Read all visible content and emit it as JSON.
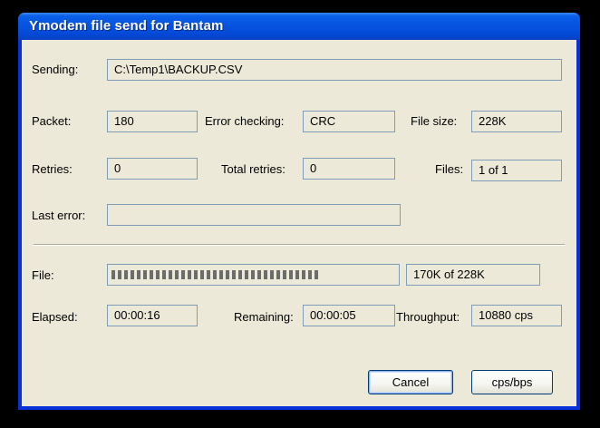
{
  "window": {
    "title": "Ymodem file send for Bantam"
  },
  "fields": {
    "sending": {
      "label": "Sending:",
      "value": "C:\\Temp1\\BACKUP.CSV"
    },
    "packet": {
      "label": "Packet:",
      "value": "180"
    },
    "error_checking": {
      "label": "Error checking:",
      "value": "CRC"
    },
    "file_size": {
      "label": "File size:",
      "value": "228K"
    },
    "retries": {
      "label": "Retries:",
      "value": "0"
    },
    "total_retries": {
      "label": "Total retries:",
      "value": "0"
    },
    "files": {
      "label": "Files:",
      "value": "1 of 1"
    },
    "last_error": {
      "label": "Last error:",
      "value": ""
    }
  },
  "progress": {
    "label": "File:",
    "text": "170K of 228K",
    "fraction": 0.746
  },
  "timing": {
    "elapsed": {
      "label": "Elapsed:",
      "value": "00:00:16"
    },
    "remaining": {
      "label": "Remaining:",
      "value": "00:00:05"
    },
    "throughput": {
      "label": "Throughput:",
      "value": "10880 cps"
    }
  },
  "buttons": {
    "cancel": "Cancel",
    "cps_bps": "cps/bps"
  },
  "colors": {
    "titlebar": "#0a5fe8",
    "dialog_bg": "#ece9d8",
    "field_border": "#7f9db9"
  }
}
